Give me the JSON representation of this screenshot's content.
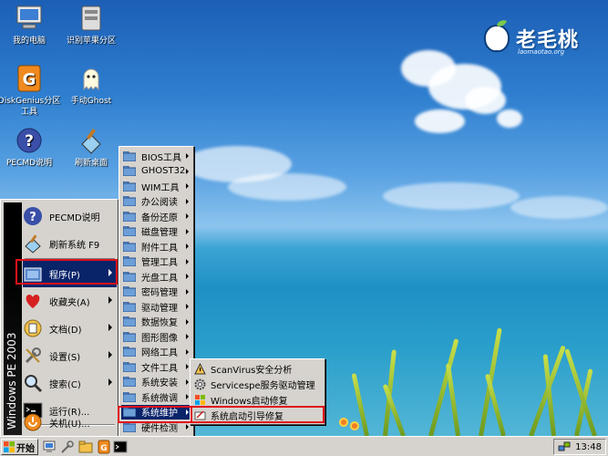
{
  "desktop": {
    "icons": [
      {
        "label": "我的电脑",
        "icon": "my-computer-icon"
      },
      {
        "label": "识别苹果分区",
        "icon": "drive-icon"
      },
      {
        "label": "DiskGenius分区工具",
        "icon": "diskgenius-icon"
      },
      {
        "label": "手动Ghost",
        "icon": "ghost-icon"
      },
      {
        "label": "PECMD说明",
        "icon": "help-icon"
      },
      {
        "label": "刷新桌面",
        "icon": "refresh-icon"
      }
    ],
    "logo": {
      "text": "老毛桃",
      "url": "laomaotao.org"
    }
  },
  "start_menu": {
    "banner": "Windows PE 2003",
    "items": [
      {
        "label": "PECMD说明",
        "icon": "help-icon"
      },
      {
        "label": "刷新系统 F9",
        "icon": "refresh-icon"
      },
      {
        "label": "程序(P)",
        "icon": "programs-folder-icon",
        "arrow": true
      },
      {
        "label": "收藏夹(A)",
        "icon": "favorites-icon",
        "arrow": true
      },
      {
        "label": "文档(D)",
        "icon": "documents-icon",
        "arrow": true
      },
      {
        "label": "设置(S)",
        "icon": "settings-icon",
        "arrow": true
      },
      {
        "label": "搜索(C)",
        "icon": "search-icon",
        "arrow": true
      },
      {
        "label": "运行(R)...",
        "icon": "run-icon"
      },
      {
        "label": "关机(U)...",
        "icon": "shutdown-icon"
      }
    ]
  },
  "programs_menu": {
    "items": [
      "BIOS工具",
      "GHOST32",
      "WIM工具",
      "办公阅读",
      "备份还原",
      "磁盘管理",
      "附件工具",
      "管理工具",
      "光盘工具",
      "密码管理",
      "驱动管理",
      "数据恢复",
      "图形图像",
      "网络工具",
      "文件工具",
      "系统安装",
      "系统微调",
      "系统维护",
      "硬件检测",
      "临时文件"
    ],
    "active": "系统维护"
  },
  "maintenance_menu": {
    "items": [
      {
        "label": "ScanVirus安全分析",
        "icon": "scan-icon"
      },
      {
        "label": "Servicespe服务驱动管理",
        "icon": "gear-icon"
      },
      {
        "label": "Windows启动修复",
        "icon": "windows-icon"
      },
      {
        "label": "系统启动引导修复",
        "icon": "repair-icon"
      }
    ]
  },
  "taskbar": {
    "start_label": "开始",
    "clock": "13:48"
  },
  "colors": {
    "highlight": "#0a246a",
    "callout": "#e0101a",
    "menu_face": "#d6d3ce"
  }
}
